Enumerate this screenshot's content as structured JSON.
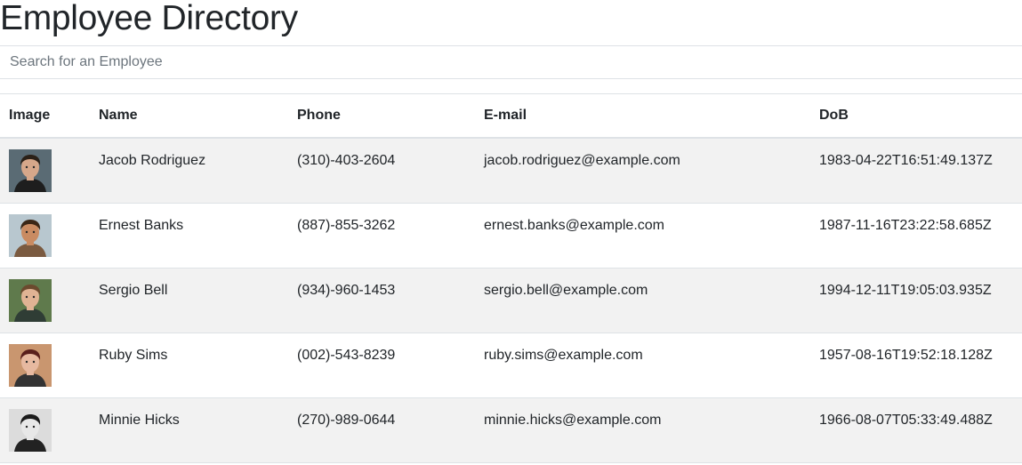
{
  "header": {
    "title": "Employee Directory"
  },
  "search": {
    "placeholder": "Search for an Employee",
    "value": ""
  },
  "table": {
    "columns": [
      "Image",
      "Name",
      "Phone",
      "E-mail",
      "DoB"
    ],
    "rows": [
      {
        "image": "avatar-jacob-rodriguez",
        "name": "Jacob Rodriguez",
        "phone": "(310)-403-2604",
        "email": "jacob.rodriguez@example.com",
        "dob": "1983-04-22T16:51:49.137Z",
        "bg": "#5a6b74",
        "skin": "#d6a78a",
        "hair": "#2b2118",
        "shirt": "#1e1e1e"
      },
      {
        "image": "avatar-ernest-banks",
        "name": "Ernest Banks",
        "phone": "(887)-855-3262",
        "email": "ernest.banks@example.com",
        "dob": "1987-11-16T23:22:58.685Z",
        "bg": "#b8c7cf",
        "skin": "#c98b62",
        "hair": "#3a2616",
        "shirt": "#7a5a40"
      },
      {
        "image": "avatar-sergio-bell",
        "name": "Sergio Bell",
        "phone": "(934)-960-1453",
        "email": "sergio.bell@example.com",
        "dob": "1994-12-11T19:05:03.935Z",
        "bg": "#5f7a4c",
        "skin": "#e0b394",
        "hair": "#6b4a2e",
        "shirt": "#2f3d35"
      },
      {
        "image": "avatar-ruby-sims",
        "name": "Ruby Sims",
        "phone": "(002)-543-8239",
        "email": "ruby.sims@example.com",
        "dob": "1957-08-16T19:52:18.128Z",
        "bg": "#c9966f",
        "skin": "#e7b9a0",
        "hair": "#5a1f1c",
        "shirt": "#333333"
      },
      {
        "image": "avatar-minnie-hicks",
        "name": "Minnie Hicks",
        "phone": "(270)-989-0644",
        "email": "minnie.hicks@example.com",
        "dob": "1966-08-07T05:33:49.488Z",
        "bg": "#dcdcdc",
        "skin": "#e8e8e8",
        "hair": "#1a1a1a",
        "shirt": "#222222"
      }
    ]
  }
}
